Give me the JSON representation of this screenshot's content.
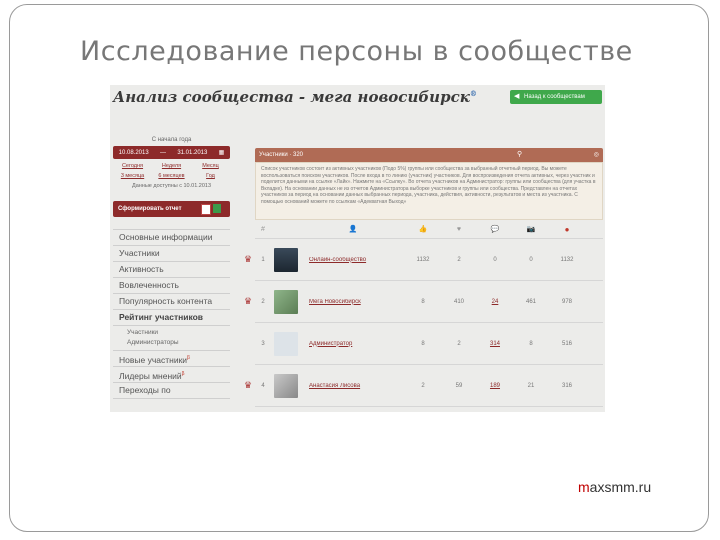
{
  "slide": {
    "title": "Исследование  персоны в сообществе",
    "footer": {
      "highlight": "m",
      "rest": "axsmm.ru"
    }
  },
  "header": {
    "title": "Анализ сообщества - мега новосибирск",
    "sup": "®",
    "back_button": "Назад к сообществам"
  },
  "sidebar": {
    "period_caption": "С начала года",
    "date_from": "10.08.2013",
    "date_sep": "—",
    "date_to": "31.01.2013",
    "quick_links": [
      "Сегодня",
      "Неделя",
      "Месяц",
      "3 месяца",
      "6 месяцев",
      "Год"
    ],
    "available_text": "Данные доступны с 10.01.2013",
    "export_label": "Сформировать отчет",
    "menu": [
      {
        "label": "Основные информации",
        "active": false
      },
      {
        "label": "Участники",
        "active": false
      },
      {
        "label": "Активность",
        "active": false
      },
      {
        "label": "Вовлеченность",
        "active": false
      },
      {
        "label": "Популярность контента",
        "active": false
      },
      {
        "label": "Рейтинг участников",
        "active": true
      }
    ],
    "submenu": [
      "Участники",
      "Администраторы"
    ],
    "menu_after": [
      {
        "label": "Новые участники",
        "beta": "β"
      },
      {
        "label": "Лидеры мнений",
        "beta": "β"
      },
      {
        "label": "Переходы по",
        "beta": ""
      }
    ]
  },
  "main": {
    "tab_label": "Участники · 320",
    "tab_right": "◎",
    "info_text": "Список участников состоит из активных участников (Подо 5%) группы или сообщества за выбранный отчетный период. Вы можете воспользоваться поиском участников. После входа в то линию (участник) участников. Для воспроизведения отчета активных, через участник и поделится данными на ссылке «Лайк». Нажмите на «Ссылку». Во отчета участников на Администратор: группы или сообщества (для участка в Вкладке). На основании данных не из отчетов Администратора выборке участников и группы или сообщества. Представлен на отчетах участников за период на основании данных выбранных периода, участника, действия, активности, результатов и места из участника. С помощью оснований можете по ссылкам «Адекватная Выход»",
    "columns": [
      "#",
      "👤",
      "👍",
      "♥",
      "💬",
      "📷",
      "●"
    ],
    "rows": [
      {
        "crown": true,
        "num": "1",
        "avatar": "dark",
        "name": "Онлайн-сообщество",
        "v1": "1132",
        "v2": "2",
        "v3": "0",
        "v4": "0",
        "v5": "1132",
        "link3": false
      },
      {
        "crown": true,
        "num": "2",
        "avatar": "green",
        "name": "Мега Новосибирск",
        "v1": "8",
        "v2": "410",
        "v3": "24",
        "v4": "461",
        "v5": "978",
        "link3": true
      },
      {
        "crown": false,
        "num": "3",
        "avatar": "camera",
        "name": "Администратор",
        "v1": "8",
        "v2": "2",
        "v3": "314",
        "v4": "8",
        "v5": "516",
        "link3": true
      },
      {
        "crown": true,
        "num": "4",
        "avatar": "gray",
        "name": "Анастасия Лисова",
        "v1": "2",
        "v2": "59",
        "v3": "189",
        "v4": "21",
        "v5": "316",
        "link3": true
      }
    ]
  }
}
